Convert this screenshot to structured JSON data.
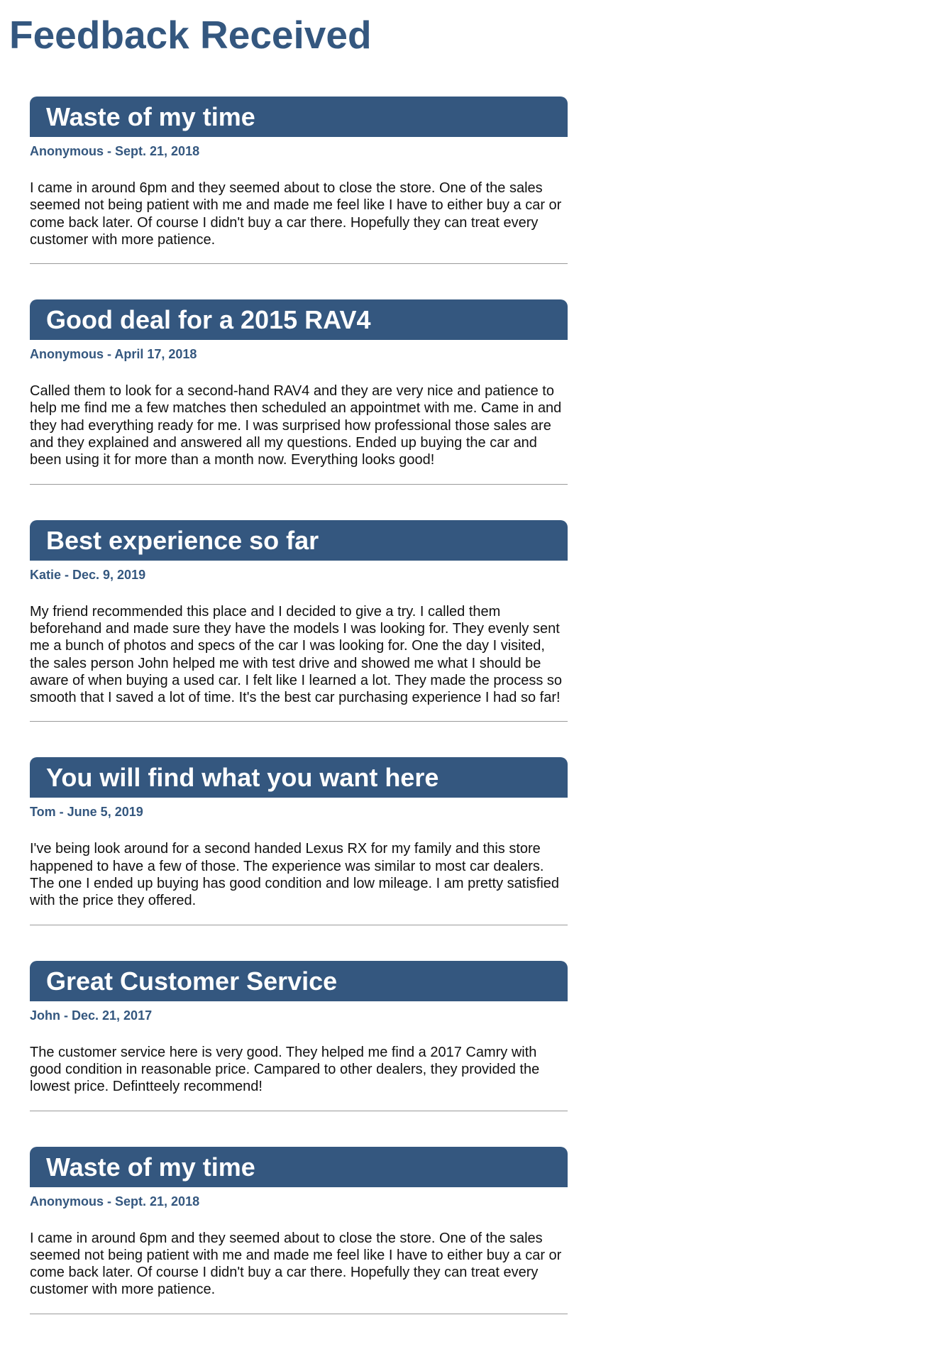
{
  "page": {
    "title": "Feedback Received"
  },
  "colors": {
    "accent": "#34577f",
    "text": "#111111",
    "divider": "#9a9a9a",
    "background": "#ffffff"
  },
  "feedback": [
    {
      "title": "Waste of my time",
      "author": "Anonymous",
      "separator": " - ",
      "date": "Sept. 21, 2018",
      "body": "I came in around 6pm and they seemed about to close the store. One of the sales seemed not being patient with me and made me feel like I have to either buy a car or come back later. Of course I didn't buy a car there. Hopefully they can treat every customer with more patience."
    },
    {
      "title": "Good deal for a 2015 RAV4",
      "author": "Anonymous",
      "separator": " - ",
      "date": "April 17, 2018",
      "body": "Called them to look for a second-hand RAV4 and they are very nice and patience to help me find me a few matches then scheduled an appointmet with me. Came in and they had everything ready for me. I was surprised how professional those sales are and they explained and answered all my questions. Ended up buying the car and been using it for more than a month now. Everything looks good!"
    },
    {
      "title": "Best experience so far",
      "author": "Katie",
      "separator": " - ",
      "date": "Dec. 9, 2019",
      "body": "My friend recommended this place and I decided to give a try. I called them beforehand and made sure they have the models I was looking for. They evenly sent me a bunch of photos and specs of the car I was looking for. One the day I visited, the sales person John helped me with test drive and showed me what I should be aware of when buying a used car. I felt like I learned a lot. They made the process so smooth that I saved a lot of time. It's the best car purchasing experience I had so far!"
    },
    {
      "title": "You will find what you want here",
      "author": "Tom",
      "separator": " - ",
      "date": "June 5, 2019",
      "body": "I've being look around for a second handed Lexus RX for my family and this store happened to have a few of those. The experience was similar to most car dealers. The one I ended up buying has good condition and low mileage. I am pretty satisfied with the price they offered."
    },
    {
      "title": "Great Customer Service",
      "author": "John",
      "separator": " - ",
      "date": "Dec. 21, 2017",
      "body": "The customer service here is very good. They helped me find a 2017 Camry with good condition in reasonable price. Campared to other dealers, they provided the lowest price. Defintteely recommend!"
    },
    {
      "title": "Waste of my time",
      "author": "Anonymous",
      "separator": " - ",
      "date": "Sept. 21, 2018",
      "body": "I came in around 6pm and they seemed about to close the store. One of the sales seemed not being patient with me and made me feel like I have to either buy a car or come back later. Of course I didn't buy a car there. Hopefully they can treat every customer with more patience."
    }
  ]
}
